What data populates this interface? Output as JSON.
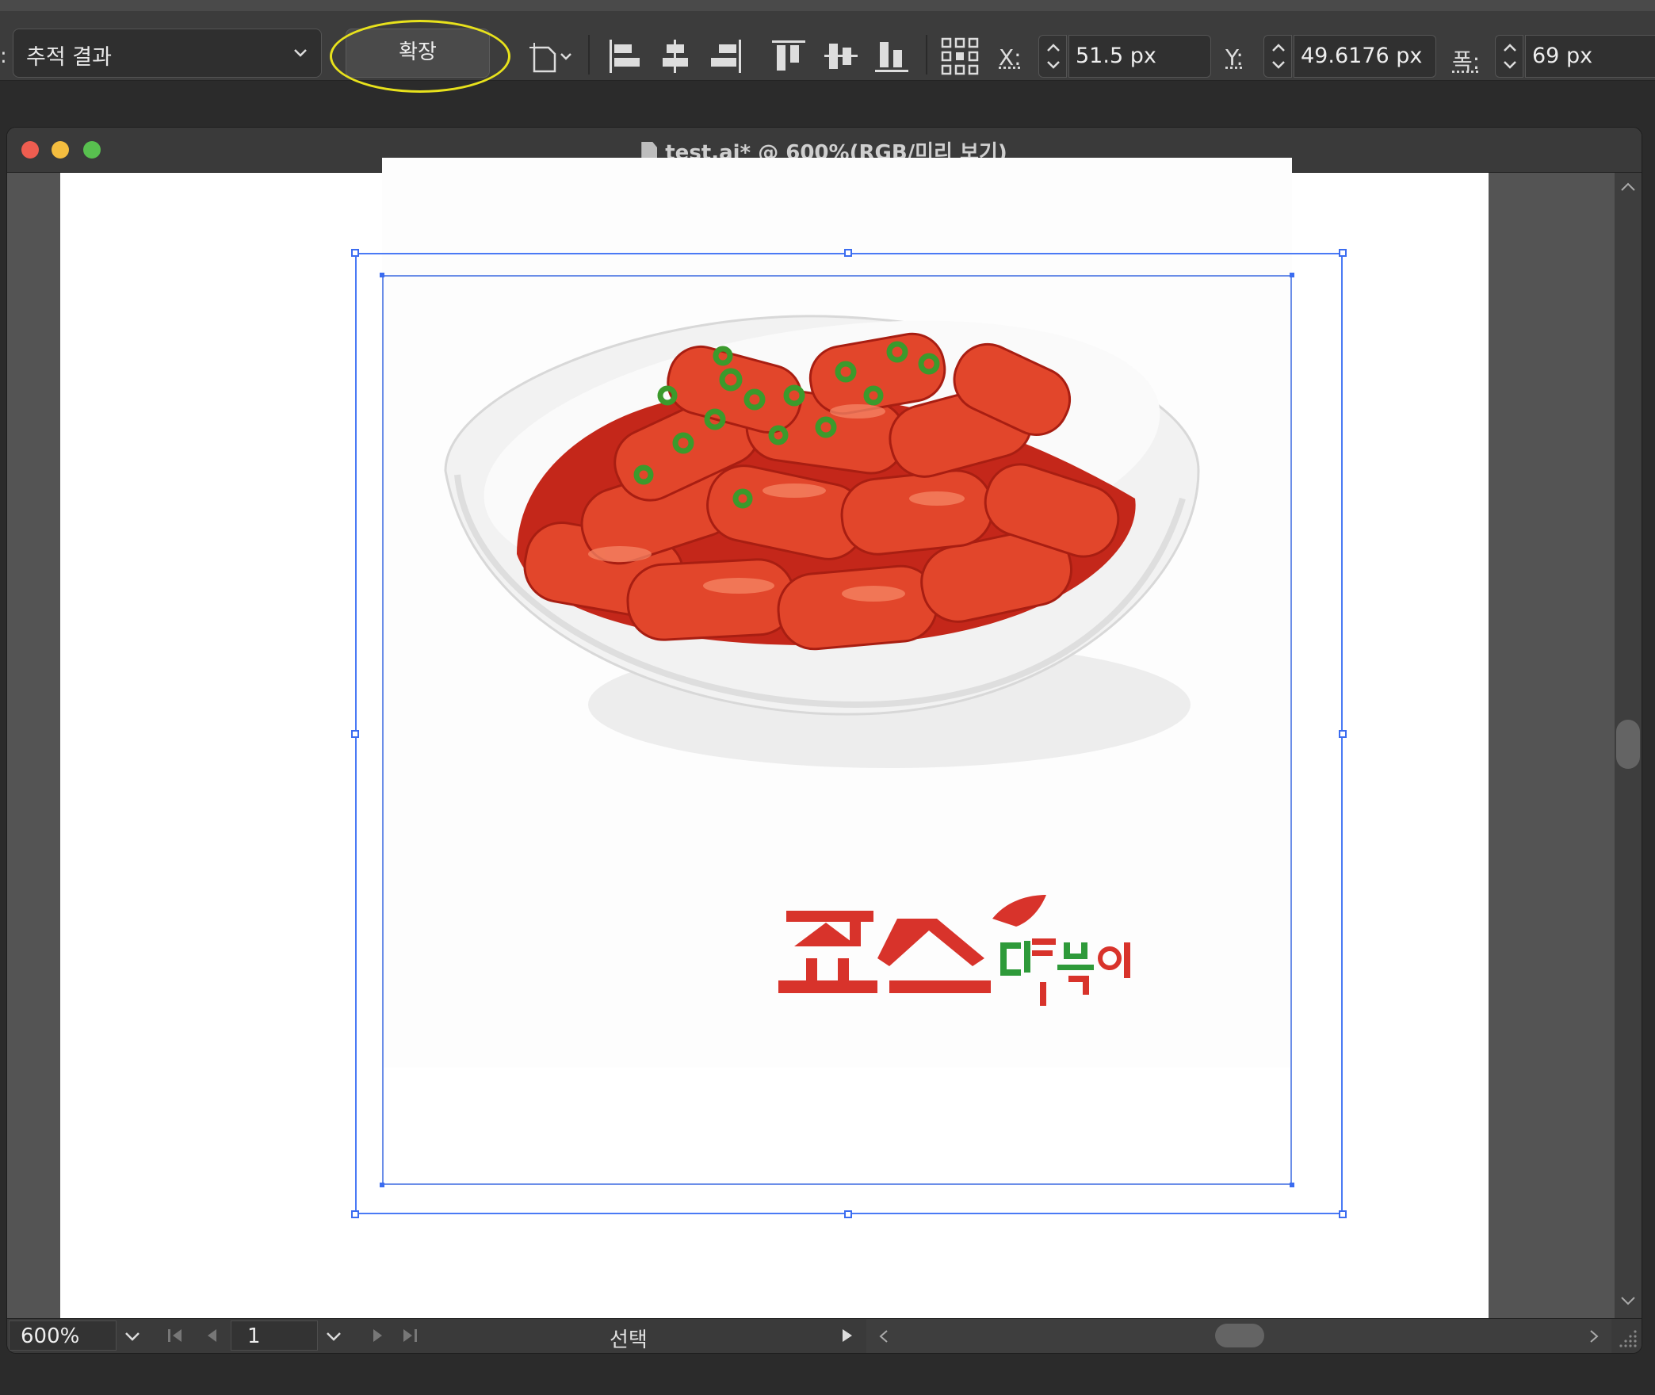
{
  "control_bar": {
    "leading_colon": ":",
    "preset_value": "추적 결과",
    "expand_label": "확장",
    "x_label": "X:",
    "x_value": "51.5 px",
    "y_label": "Y:",
    "y_value": "49.6176 px",
    "w_label": "폭:",
    "w_value": "69 px",
    "highlight_color": "#e8e21c"
  },
  "document": {
    "title": "test.ai* @ 600%(RGB/미리 보기)",
    "logo_text": "죠스떡볶이"
  },
  "status_bar": {
    "zoom": "600%",
    "page": "1",
    "tool_status": "선택"
  },
  "colors": {
    "selection": "#3b6cf0",
    "traffic_close": "#ee5d50",
    "traffic_min": "#f4bd3f",
    "traffic_max": "#58c04f"
  },
  "icons": [
    "chevron-down-icon",
    "artboard-options-icon",
    "align-left-icon",
    "align-hcenter-icon",
    "align-right-icon",
    "align-top-icon",
    "align-vcenter-icon",
    "align-bottom-icon",
    "reference-point-icon",
    "stepper-icon",
    "file-icon",
    "first-page-icon",
    "prev-page-icon",
    "next-page-icon",
    "last-page-icon",
    "play-icon",
    "scroll-left-icon",
    "scroll-right-icon",
    "scroll-up-icon",
    "scroll-down-icon",
    "resize-grip-icon"
  ]
}
